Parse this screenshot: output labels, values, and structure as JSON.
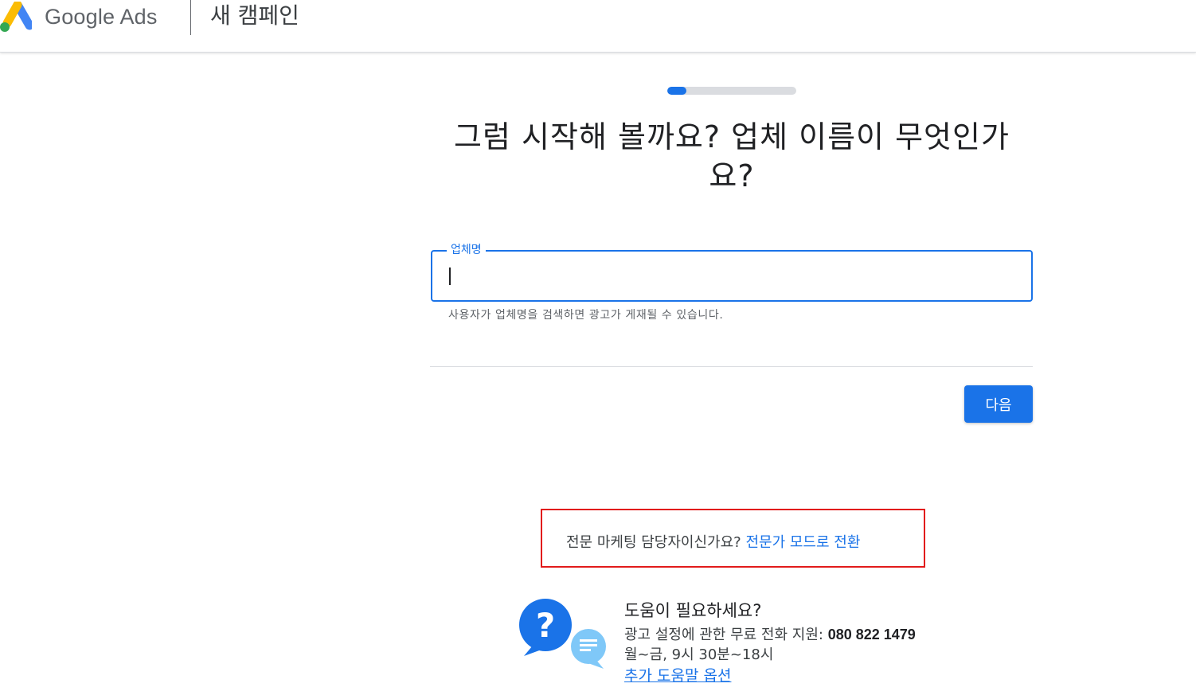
{
  "header": {
    "product_name": "Google Ads",
    "page_title": "새 캠페인"
  },
  "progress": {
    "value_percent": 15
  },
  "main": {
    "headline": "그럼 시작해 볼까요? 업체 이름이 무엇인가요?",
    "business_name_field": {
      "label": "업체명",
      "value": "",
      "placeholder": "",
      "helper": "사용자가 업체명을 검색하면 광고가 게재될 수 있습니다."
    },
    "next_label": "다음"
  },
  "expert_mode": {
    "prompt": "전문 마케팅 담당자이신가요?",
    "link": "전문가 모드로 전환"
  },
  "help": {
    "title": "도움이 필요하세요?",
    "phone_prefix": "광고 설정에 관한 무료 전화 지원:",
    "phone_number": "080 822 1479",
    "hours": "월~금, 9시 30분~18시",
    "more_link": "추가 도움말 옵션"
  },
  "colors": {
    "accent": "#1a73e8",
    "highlight_border": "#e21b1b",
    "text": "#202124",
    "muted": "#5f6368"
  },
  "icons": [
    "google-ads-logo-icon",
    "help-chat-bubble-icon"
  ]
}
